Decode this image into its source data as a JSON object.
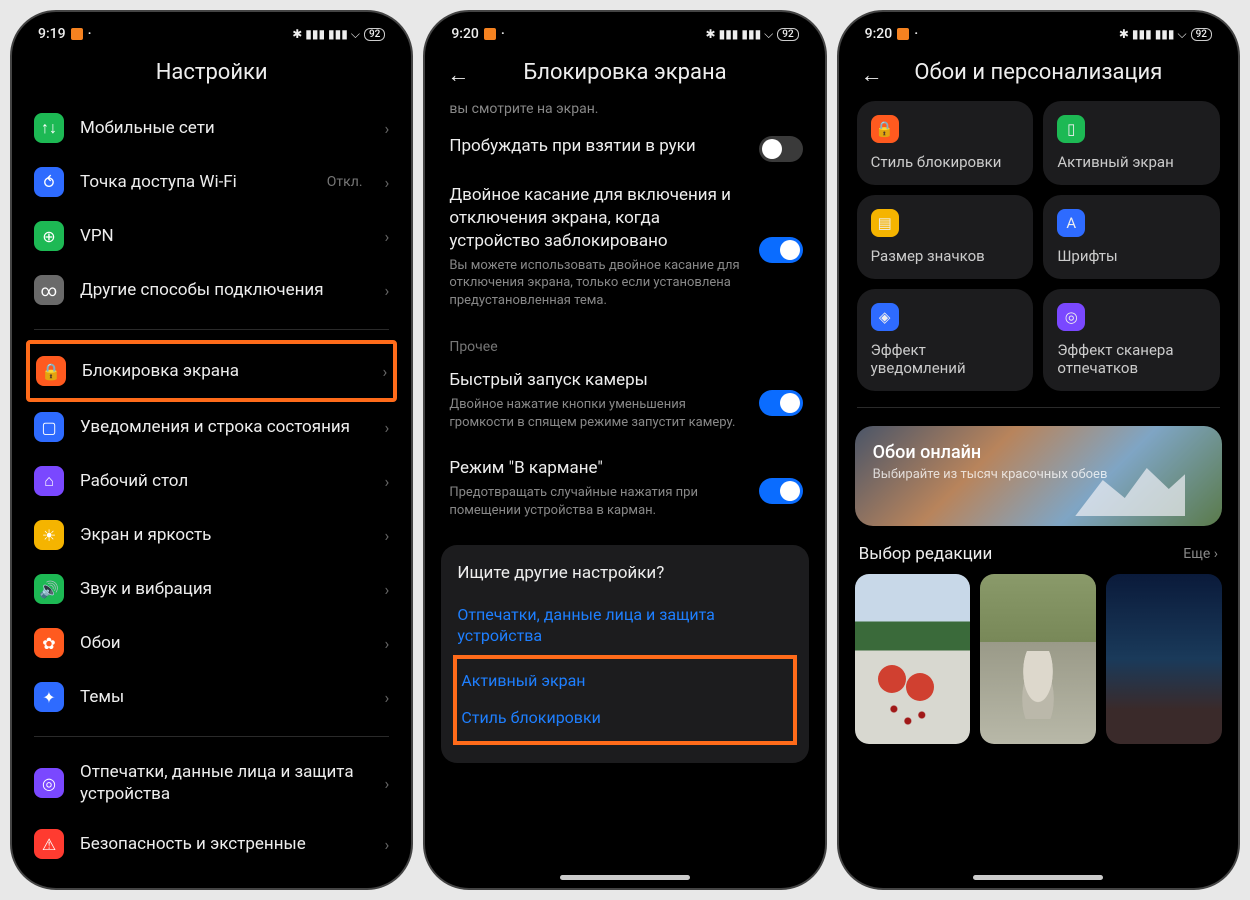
{
  "status": {
    "t1": "9:19",
    "t2": "9:20",
    "t3": "9:20",
    "batt": "92"
  },
  "s1": {
    "title": "Настройки",
    "items": [
      {
        "label": "Мобильные сети",
        "color": "#1db954",
        "glyph": "↑↓"
      },
      {
        "label": "Точка доступа Wi-Fi",
        "trail": "Откл.",
        "color": "#2e6bff",
        "glyph": "⥀"
      },
      {
        "label": "VPN",
        "color": "#1db954",
        "glyph": "⊕"
      },
      {
        "label": "Другие способы подключения",
        "color": "#6a6a6a",
        "glyph": "∞"
      }
    ],
    "items2": [
      {
        "label": "Блокировка экрана",
        "color": "#ff5a1f",
        "glyph": "🔒",
        "hl": true
      },
      {
        "label": "Уведомления и строка состояния",
        "color": "#2e6bff",
        "glyph": "▢"
      },
      {
        "label": "Рабочий стол",
        "color": "#7a48ff",
        "glyph": "⌂"
      },
      {
        "label": "Экран и яркость",
        "color": "#f5b400",
        "glyph": "☀"
      },
      {
        "label": "Звук и вибрация",
        "color": "#1db954",
        "glyph": "🔊"
      },
      {
        "label": "Обои",
        "color": "#ff5a1f",
        "glyph": "✿"
      },
      {
        "label": "Темы",
        "color": "#2e6bff",
        "glyph": "✦"
      }
    ],
    "items3": [
      {
        "label": "Отпечатки, данные лица и защита устройства",
        "color": "#7a48ff",
        "glyph": "◎"
      },
      {
        "label": "Безопасность и экстренные",
        "color": "#ff3b30",
        "glyph": "⚠"
      }
    ]
  },
  "s2": {
    "title": "Блокировка экрана",
    "cut": "вы смотрите на экран.",
    "set1": {
      "title": "Пробуждать при взятии в руки"
    },
    "set2": {
      "title": "Двойное касание для включения и отключения экрана, когда устройство заблокировано",
      "desc": "Вы можете использовать двойное касание для отключения экрана, только если установлена предустановленная тема."
    },
    "seclabel": "Прочее",
    "set3": {
      "title": "Быстрый запуск камеры",
      "desc": "Двойное нажатие кнопки уменьшения громкости в спящем режиме запустит камеру."
    },
    "set4": {
      "title": "Режим \"В кармане\"",
      "desc": "Предотвращать случайные нажатия при помещении устройства в карман."
    },
    "other": {
      "q": "Ищите другие настройки?",
      "l1": "Отпечатки, данные лица и защита устройства",
      "l2": "Активный экран",
      "l3": "Стиль блокировки"
    }
  },
  "s3": {
    "title": "Обои и персонализация",
    "cards": [
      {
        "label": "Стиль блокировки",
        "color": "#ff5a1f",
        "glyph": "🔒"
      },
      {
        "label": "Активный экран",
        "color": "#1db954",
        "glyph": "▯"
      },
      {
        "label": "Размер значков",
        "color": "#f5b400",
        "glyph": "▤"
      },
      {
        "label": "Шрифты",
        "color": "#2e6bff",
        "glyph": "A"
      },
      {
        "label": "Эффект уведомлений",
        "color": "#2e6bff",
        "glyph": "◈"
      },
      {
        "label": "Эффект сканера отпечатков",
        "color": "#7a48ff",
        "glyph": "◎"
      }
    ],
    "banner": {
      "t": "Обои онлайн",
      "d": "Выбирайте из тысяч красочных обоев"
    },
    "sel": {
      "t": "Выбор редакции",
      "more": "Еще"
    }
  }
}
